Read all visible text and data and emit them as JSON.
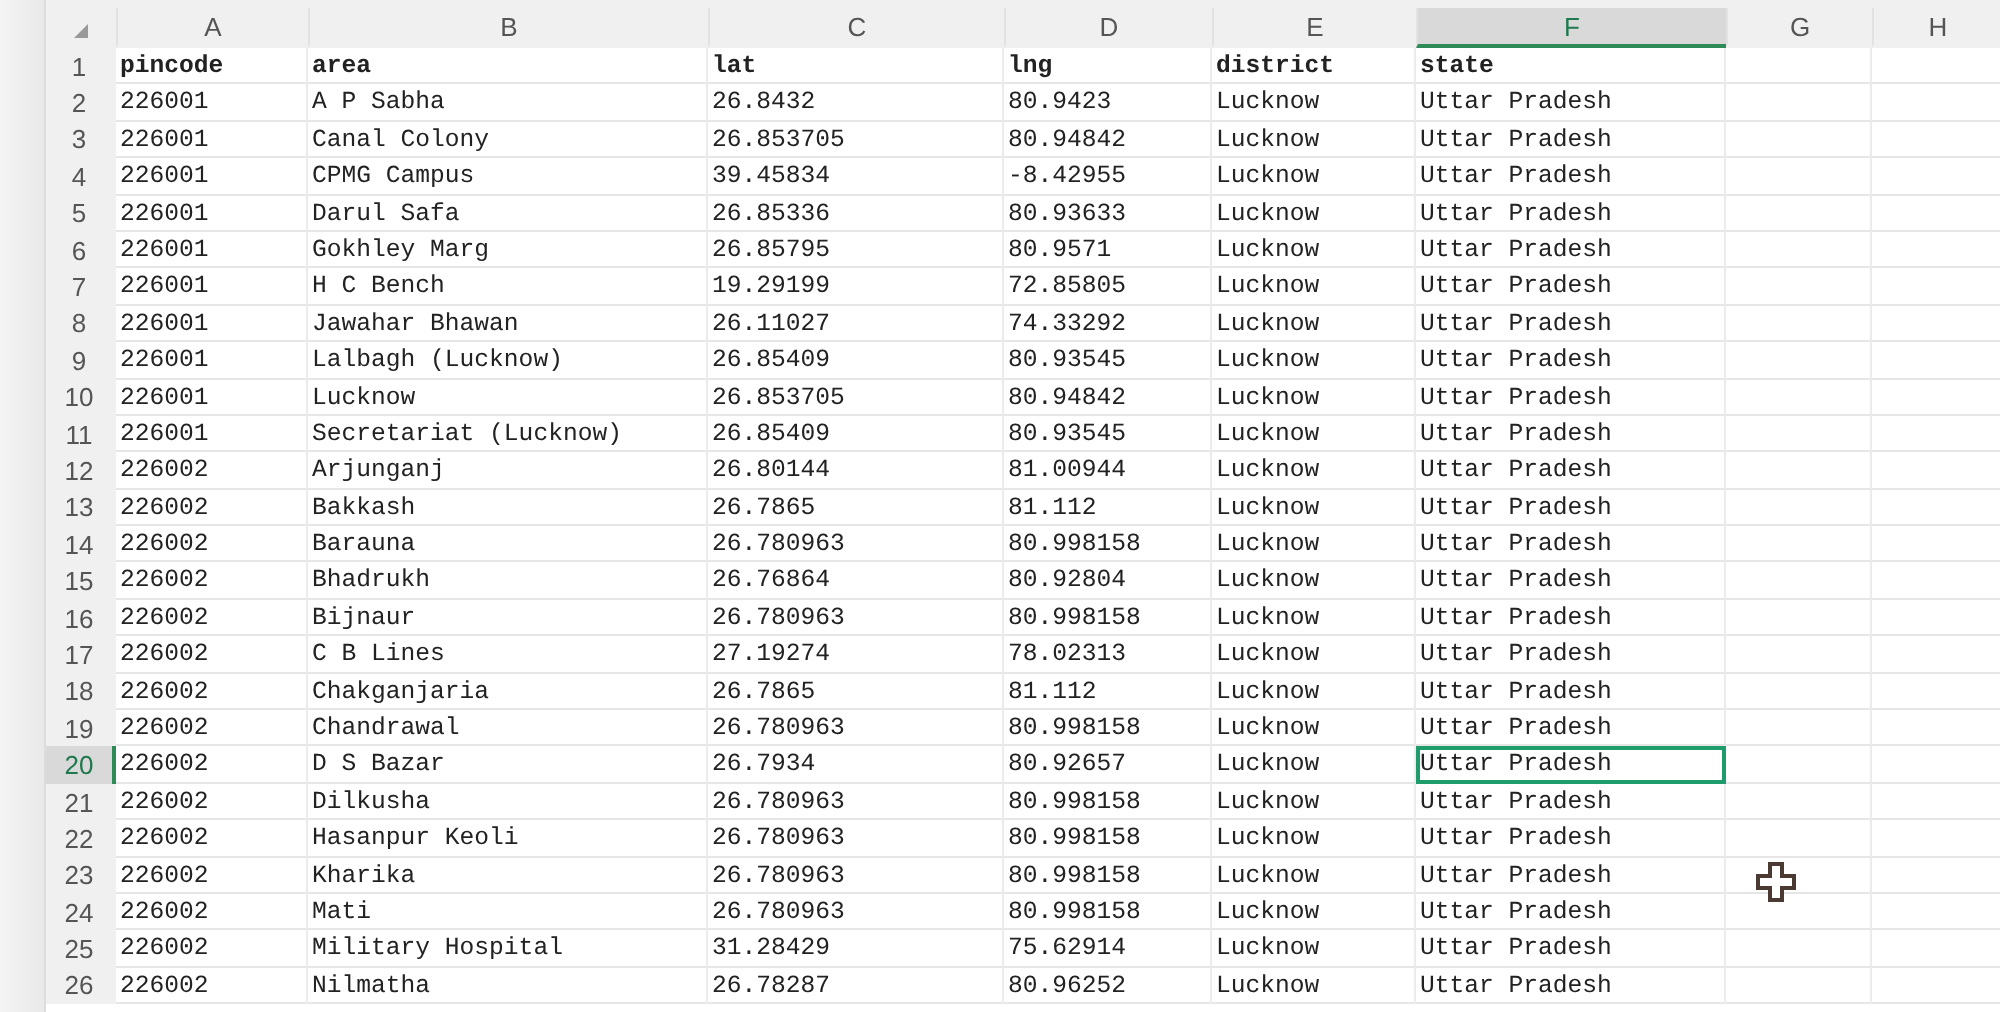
{
  "columns": [
    {
      "label": "A",
      "selected": false
    },
    {
      "label": "B",
      "selected": false
    },
    {
      "label": "C",
      "selected": false
    },
    {
      "label": "D",
      "selected": false
    },
    {
      "label": "E",
      "selected": false
    },
    {
      "label": "F",
      "selected": true
    },
    {
      "label": "G",
      "selected": false
    },
    {
      "label": "H",
      "selected": false
    }
  ],
  "rows": [
    {
      "number": "1",
      "selected": false,
      "header": true,
      "cells": [
        "pincode",
        "area",
        "lat",
        "lng",
        "district",
        "state"
      ]
    },
    {
      "number": "2",
      "selected": false,
      "header": false,
      "cells": [
        "226001",
        "A P Sabha",
        "26.8432",
        "80.9423",
        "Lucknow",
        "Uttar Pradesh"
      ]
    },
    {
      "number": "3",
      "selected": false,
      "header": false,
      "cells": [
        "226001",
        "Canal Colony",
        "26.853705",
        "80.94842",
        "Lucknow",
        "Uttar Pradesh"
      ]
    },
    {
      "number": "4",
      "selected": false,
      "header": false,
      "cells": [
        "226001",
        "CPMG Campus",
        "39.45834",
        "-8.42955",
        "Lucknow",
        "Uttar Pradesh"
      ]
    },
    {
      "number": "5",
      "selected": false,
      "header": false,
      "cells": [
        "226001",
        "Darul Safa",
        "26.85336",
        "80.93633",
        "Lucknow",
        "Uttar Pradesh"
      ]
    },
    {
      "number": "6",
      "selected": false,
      "header": false,
      "cells": [
        "226001",
        "Gokhley Marg",
        "26.85795",
        "80.9571",
        "Lucknow",
        "Uttar Pradesh"
      ]
    },
    {
      "number": "7",
      "selected": false,
      "header": false,
      "cells": [
        "226001",
        "H C Bench",
        "19.29199",
        "72.85805",
        "Lucknow",
        "Uttar Pradesh"
      ]
    },
    {
      "number": "8",
      "selected": false,
      "header": false,
      "cells": [
        "226001",
        "Jawahar Bhawan",
        "26.11027",
        "74.33292",
        "Lucknow",
        "Uttar Pradesh"
      ]
    },
    {
      "number": "9",
      "selected": false,
      "header": false,
      "cells": [
        "226001",
        "Lalbagh (Lucknow)",
        "26.85409",
        "80.93545",
        "Lucknow",
        "Uttar Pradesh"
      ]
    },
    {
      "number": "10",
      "selected": false,
      "header": false,
      "cells": [
        "226001",
        "Lucknow",
        "26.853705",
        "80.94842",
        "Lucknow",
        "Uttar Pradesh"
      ]
    },
    {
      "number": "11",
      "selected": false,
      "header": false,
      "cells": [
        "226001",
        "Secretariat (Lucknow)",
        "26.85409",
        "80.93545",
        "Lucknow",
        "Uttar Pradesh"
      ]
    },
    {
      "number": "12",
      "selected": false,
      "header": false,
      "cells": [
        "226002",
        "Arjunganj",
        "26.80144",
        "81.00944",
        "Lucknow",
        "Uttar Pradesh"
      ]
    },
    {
      "number": "13",
      "selected": false,
      "header": false,
      "cells": [
        "226002",
        "Bakkash",
        "26.7865",
        "81.112",
        "Lucknow",
        "Uttar Pradesh"
      ]
    },
    {
      "number": "14",
      "selected": false,
      "header": false,
      "cells": [
        "226002",
        "Barauna",
        "26.780963",
        "80.998158",
        "Lucknow",
        "Uttar Pradesh"
      ]
    },
    {
      "number": "15",
      "selected": false,
      "header": false,
      "cells": [
        "226002",
        "Bhadrukh",
        "26.76864",
        "80.92804",
        "Lucknow",
        "Uttar Pradesh"
      ]
    },
    {
      "number": "16",
      "selected": false,
      "header": false,
      "cells": [
        "226002",
        "Bijnaur",
        "26.780963",
        "80.998158",
        "Lucknow",
        "Uttar Pradesh"
      ]
    },
    {
      "number": "17",
      "selected": false,
      "header": false,
      "cells": [
        "226002",
        "C B Lines",
        "27.19274",
        "78.02313",
        "Lucknow",
        "Uttar Pradesh"
      ]
    },
    {
      "number": "18",
      "selected": false,
      "header": false,
      "cells": [
        "226002",
        "Chakganjaria",
        "26.7865",
        "81.112",
        "Lucknow",
        "Uttar Pradesh"
      ]
    },
    {
      "number": "19",
      "selected": false,
      "header": false,
      "cells": [
        "226002",
        "Chandrawal",
        "26.780963",
        "80.998158",
        "Lucknow",
        "Uttar Pradesh"
      ]
    },
    {
      "number": "20",
      "selected": true,
      "header": false,
      "cells": [
        "226002",
        "D S Bazar",
        "26.7934",
        "80.92657",
        "Lucknow",
        "Uttar Pradesh"
      ]
    },
    {
      "number": "21",
      "selected": false,
      "header": false,
      "cells": [
        "226002",
        "Dilkusha",
        "26.780963",
        "80.998158",
        "Lucknow",
        "Uttar Pradesh"
      ]
    },
    {
      "number": "22",
      "selected": false,
      "header": false,
      "cells": [
        "226002",
        "Hasanpur Keoli",
        "26.780963",
        "80.998158",
        "Lucknow",
        "Uttar Pradesh"
      ]
    },
    {
      "number": "23",
      "selected": false,
      "header": false,
      "cells": [
        "226002",
        "Kharika",
        "26.780963",
        "80.998158",
        "Lucknow",
        "Uttar Pradesh"
      ]
    },
    {
      "number": "24",
      "selected": false,
      "header": false,
      "cells": [
        "226002",
        "Mati",
        "26.780963",
        "80.998158",
        "Lucknow",
        "Uttar Pradesh"
      ]
    },
    {
      "number": "25",
      "selected": false,
      "header": false,
      "cells": [
        "226002",
        "Military Hospital",
        "31.28429",
        "75.62914",
        "Lucknow",
        "Uttar Pradesh"
      ]
    },
    {
      "number": "26",
      "selected": false,
      "header": false,
      "cells": [
        "226002",
        "Nilmatha",
        "26.78287",
        "80.96252",
        "Lucknow",
        "Uttar Pradesh"
      ]
    }
  ]
}
